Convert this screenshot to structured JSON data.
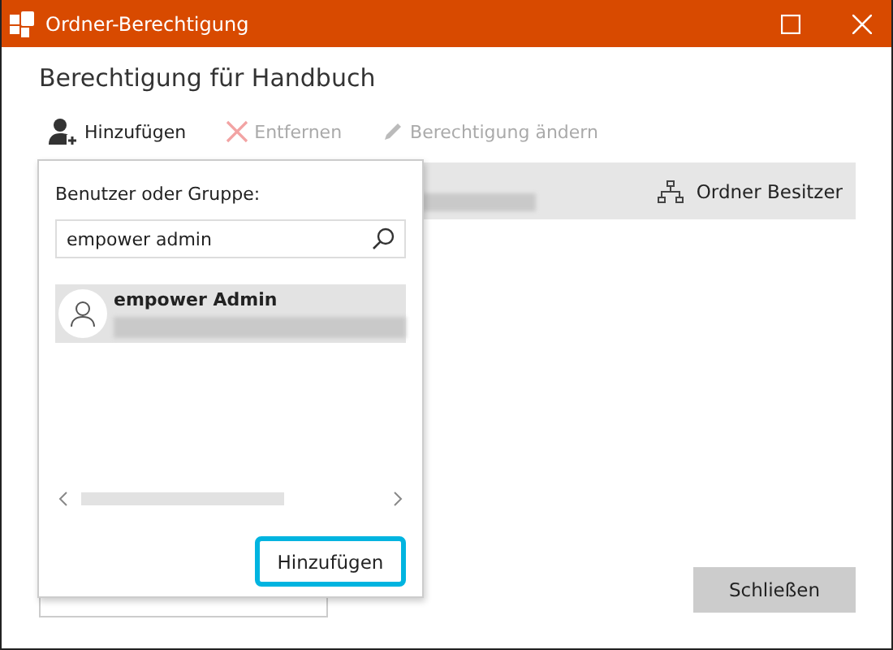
{
  "window": {
    "title": "Ordner-Berechtigung"
  },
  "heading": "Berechtigung für Handbuch",
  "toolbar": [
    {
      "label": "Hinzufügen",
      "kind": "add",
      "disabled": false
    },
    {
      "label": "Entfernen",
      "kind": "remove",
      "disabled": true
    },
    {
      "label": "Berechtigung ändern",
      "kind": "edit",
      "disabled": true
    }
  ],
  "owner_bar": {
    "label": "Ordner Besitzer"
  },
  "popup": {
    "label": "Benutzer oder Gruppe:",
    "search": {
      "value": "empower admin"
    },
    "results": [
      {
        "name": "empower Admin",
        "selected": true
      }
    ],
    "button": "Hinzufügen"
  },
  "footer": {
    "close": "Schließen"
  }
}
